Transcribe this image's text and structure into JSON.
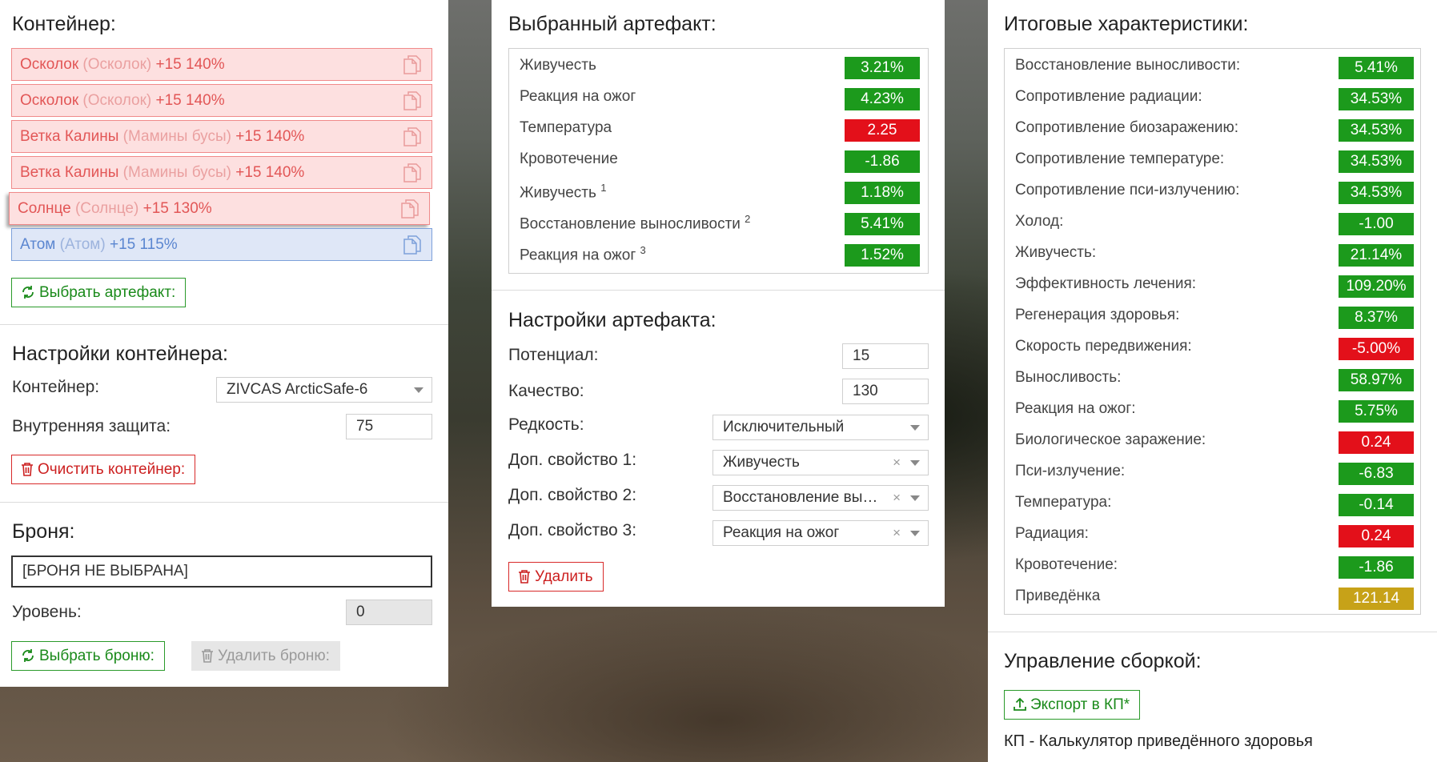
{
  "container": {
    "title": "Контейнер:",
    "items": [
      {
        "name": "Осколок",
        "sub": "(Осколок)",
        "level": "+15 140%"
      },
      {
        "name": "Осколок",
        "sub": "(Осколок)",
        "level": "+15 140%"
      },
      {
        "name": "Ветка Калины",
        "sub": "(Мамины бусы)",
        "level": "+15 140%"
      },
      {
        "name": "Ветка Калины",
        "sub": "(Мамины бусы)",
        "level": "+15 140%"
      },
      {
        "name": "Солнце",
        "sub": "(Солнце)",
        "level": "+15 130%"
      },
      {
        "name": "Атом",
        "sub": "(Атом)",
        "level": "+15 115%"
      }
    ],
    "select_button": "Выбрать артефакт:"
  },
  "container_settings": {
    "title": "Настройки контейнера:",
    "container_label": "Контейнер:",
    "container_value": "ZIVCAS ArcticSafe-6",
    "protection_label": "Внутренняя защита:",
    "protection_value": "75",
    "clear_button": "Очистить контейнер:"
  },
  "armor": {
    "title": "Броня:",
    "value": "[БРОНЯ НЕ ВЫБРАНА]",
    "level_label": "Уровень:",
    "level_value": "0",
    "select_button": "Выбрать броню:",
    "delete_button": "Удалить броню:"
  },
  "selected_artifact": {
    "title": "Выбранный артефакт:",
    "stats": [
      {
        "label": "Живучесть",
        "sup": "",
        "value": "3.21%",
        "color": "green"
      },
      {
        "label": "Реакция на ожог",
        "sup": "",
        "value": "4.23%",
        "color": "green"
      },
      {
        "label": "Температура",
        "sup": "",
        "value": "2.25",
        "color": "red"
      },
      {
        "label": "Кровотечение",
        "sup": "",
        "value": "-1.86",
        "color": "green"
      },
      {
        "label": "Живучесть",
        "sup": "1",
        "value": "1.18%",
        "color": "green"
      },
      {
        "label": "Восстановление выносливости",
        "sup": "2",
        "value": "5.41%",
        "color": "green"
      },
      {
        "label": "Реакция на ожог",
        "sup": "3",
        "value": "1.52%",
        "color": "green"
      }
    ]
  },
  "artifact_settings": {
    "title": "Настройки артефакта:",
    "potential_label": "Потенциал:",
    "potential_value": "15",
    "quality_label": "Качество:",
    "quality_value": "130",
    "rarity_label": "Редкость:",
    "rarity_value": "Исключительный",
    "prop1_label": "Доп. свойство 1:",
    "prop1_value": "Живучесть",
    "prop2_label": "Доп. свойство 2:",
    "prop2_value": "Восстановление выносливости",
    "prop3_label": "Доп. свойство 3:",
    "prop3_value": "Реакция на ожог",
    "clear_symbol": "×",
    "delete_button": "Удалить"
  },
  "totals": {
    "title": "Итоговые характеристики:",
    "stats": [
      {
        "label": "Восстановление выносливости:",
        "value": "5.41%",
        "color": "green"
      },
      {
        "label": "Сопротивление радиации:",
        "value": "34.53%",
        "color": "green"
      },
      {
        "label": "Сопротивление биозаражению:",
        "value": "34.53%",
        "color": "green"
      },
      {
        "label": "Сопротивление температуре:",
        "value": "34.53%",
        "color": "green"
      },
      {
        "label": "Сопротивление пси-излучению:",
        "value": "34.53%",
        "color": "green"
      },
      {
        "label": "Холод:",
        "value": "-1.00",
        "color": "green"
      },
      {
        "label": "Живучесть:",
        "value": "21.14%",
        "color": "green"
      },
      {
        "label": "Эффективность лечения:",
        "value": "109.20%",
        "color": "green"
      },
      {
        "label": "Регенерация здоровья:",
        "value": "8.37%",
        "color": "green"
      },
      {
        "label": "Скорость передвижения:",
        "value": "-5.00%",
        "color": "red"
      },
      {
        "label": "Выносливость:",
        "value": "58.97%",
        "color": "green"
      },
      {
        "label": "Реакция на ожог:",
        "value": "5.75%",
        "color": "green"
      },
      {
        "label": "Биологическое заражение:",
        "value": "0.24",
        "color": "red"
      },
      {
        "label": "Пси-излучение:",
        "value": "-6.83",
        "color": "green"
      },
      {
        "label": "Температура:",
        "value": "-0.14",
        "color": "green"
      },
      {
        "label": "Радиация:",
        "value": "0.24",
        "color": "red"
      },
      {
        "label": "Кровотечение:",
        "value": "-1.86",
        "color": "green"
      },
      {
        "label": "Приведёнка",
        "value": "121.14",
        "color": "yellow"
      }
    ]
  },
  "build": {
    "title": "Управление сборкой:",
    "export_button": "Экспорт в КП*",
    "footnote": "КП - Калькулятор приведённого здоровья"
  },
  "colors": {
    "green": "#1c9a1c",
    "red": "#e3101a",
    "yellow": "#c7a218"
  }
}
